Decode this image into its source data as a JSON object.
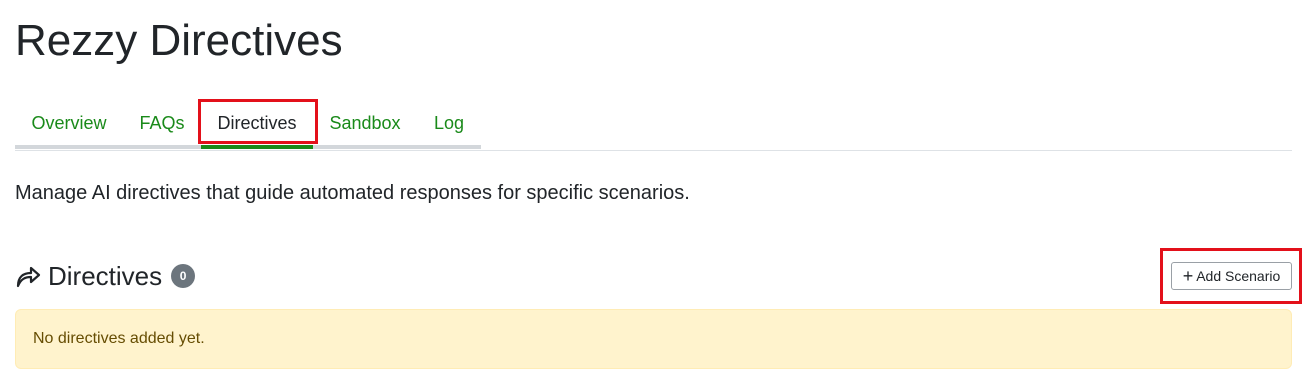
{
  "page": {
    "title": "Rezzy Directives",
    "description": "Manage AI directives that guide automated responses for specific scenarios."
  },
  "tabs": [
    {
      "label": "Overview",
      "active": false
    },
    {
      "label": "FAQs",
      "active": false
    },
    {
      "label": "Directives",
      "active": true
    },
    {
      "label": "Sandbox",
      "active": false
    },
    {
      "label": "Log",
      "active": false
    }
  ],
  "section": {
    "icon": "share-icon",
    "title": "Directives",
    "count": "0",
    "add_button_label": "Add Scenario",
    "add_button_icon": "plus-icon",
    "empty_message": "No directives added yet."
  },
  "colors": {
    "link_green": "#1a8a1a",
    "active_underline": "#198a19",
    "highlight_red": "#e3101a",
    "badge_gray": "#6c757d",
    "alert_background": "#fff3cd",
    "alert_text": "#664d03"
  }
}
